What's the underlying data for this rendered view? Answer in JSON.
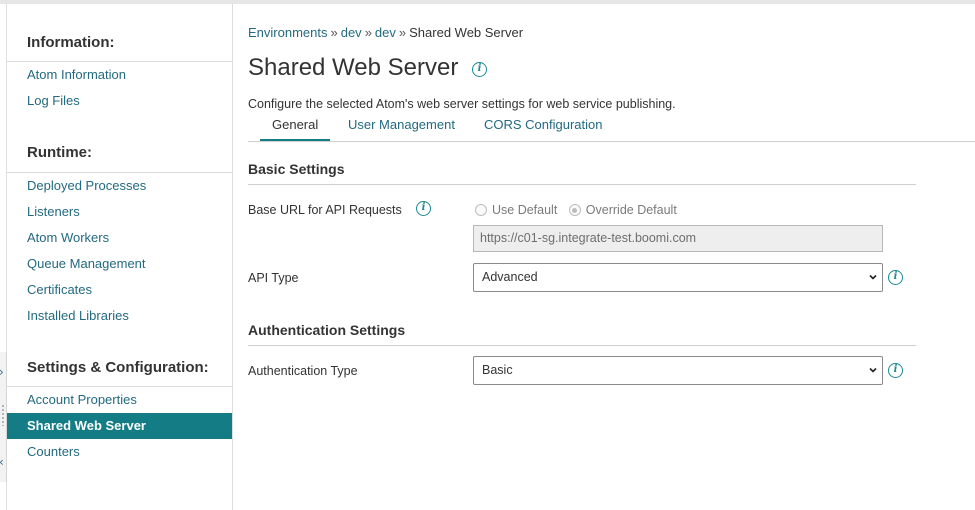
{
  "sidebar": {
    "sections": [
      {
        "title": "Information:",
        "items": [
          "Atom Information",
          "Log Files"
        ]
      },
      {
        "title": "Runtime:",
        "items": [
          "Deployed Processes",
          "Listeners",
          "Atom Workers",
          "Queue Management",
          "Certificates",
          "Installed Libraries"
        ]
      },
      {
        "title": "Settings & Configuration:",
        "items": [
          "Account Properties",
          "Shared Web Server",
          "Counters"
        ]
      }
    ],
    "active_item": "Shared Web Server"
  },
  "breadcrumb": [
    "Environments",
    "dev",
    "dev",
    "Shared Web Server"
  ],
  "breadcrumb_separator": "»",
  "page": {
    "title": "Shared Web Server",
    "description": "Configure the selected Atom's web server settings for web service publishing."
  },
  "tabs": [
    {
      "label": "General",
      "active": true
    },
    {
      "label": "User Management",
      "active": false
    },
    {
      "label": "CORS Configuration",
      "active": false
    }
  ],
  "basic_settings": {
    "title": "Basic Settings",
    "base_url": {
      "label": "Base URL for API Requests",
      "options": [
        "Use Default",
        "Override Default"
      ],
      "selected": "Override Default",
      "value": "https://c01-sg.integrate-test.boomi.com",
      "disabled": true
    },
    "api_type": {
      "label": "API Type",
      "value": "Advanced"
    }
  },
  "authentication_settings": {
    "title": "Authentication Settings",
    "auth_type": {
      "label": "Authentication Type",
      "value": "Basic"
    }
  },
  "colors": {
    "accent": "#147c85",
    "link": "#236a80",
    "info_icon": "#1d8a93"
  },
  "icons": [
    "info-icon",
    "chevron-down-icon",
    "chevron-right-icon",
    "chevron-left-icon"
  ]
}
